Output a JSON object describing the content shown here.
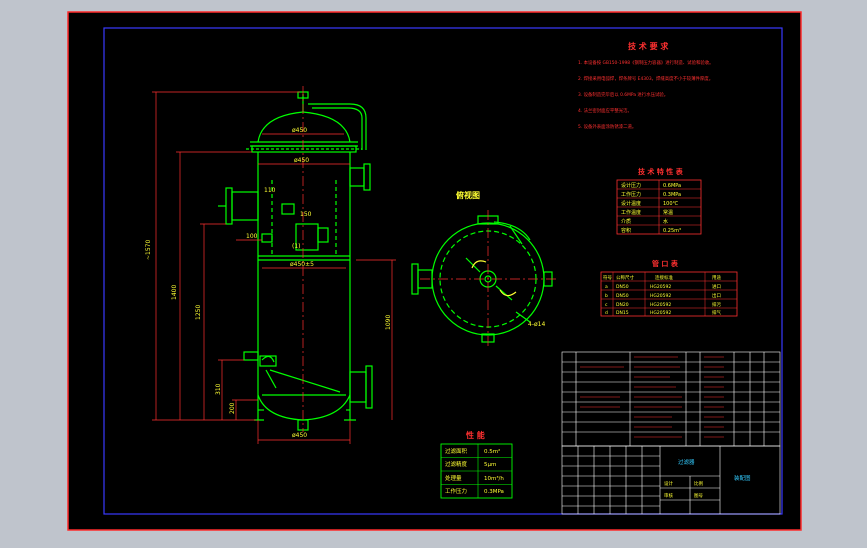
{
  "colors": {
    "viewport_bg": "#bfc4cc",
    "sheet_bg": "#000000",
    "outer_border": "#ff2a2a",
    "inner_border": "#3a3aff",
    "geometry": "#00ff00",
    "dimension": "#ff3030",
    "text_yellow": "#ffff33",
    "table_line": "#ffffff",
    "accent_cyan": "#33ccff",
    "accent_magenta": "#ff33ff"
  },
  "elevation": {
    "dia_top": "ø450",
    "dia_body": "ø450",
    "dia_inner": "ø450±5",
    "dia_bottom": "ø450",
    "overall_height": "~1570",
    "height_2": "1400",
    "height_3": "1250",
    "height_4": "1090",
    "height_5": "310",
    "height_6": "200",
    "nozzle_label_a": "110",
    "nozzle_label_b": "100",
    "nozzle_label_c": "150",
    "marker": "(1)"
  },
  "plan": {
    "title": "俯视图",
    "bolt_note": "4-ø14"
  },
  "tech_req": {
    "title": "技 术 要 求",
    "lines": [
      "1. 本设备按 GB150-1998《钢制压力容器》进行制造、试验和验收。",
      "2. 焊接采用电弧焊，焊条牌号 E4303，焊缝高度不小于较薄件厚度。",
      "3. 设备制造完毕后以 0.6MPa 进行水压试验。",
      "4. 法兰密封面应平整光洁。",
      "5. 设备外表面涂防锈漆二道。"
    ]
  },
  "spec_table": {
    "title": "技 术 特 性 表",
    "rows": [
      [
        "设计压力",
        "0.6MPa"
      ],
      [
        "工作压力",
        "0.3MPa"
      ],
      [
        "设计温度",
        "100℃"
      ],
      [
        "工作温度",
        "常温"
      ],
      [
        "介质",
        "水"
      ],
      [
        "容积",
        "0.25m³"
      ]
    ]
  },
  "nozzle_table": {
    "title": "管 口 表",
    "headers": [
      "符号",
      "公称尺寸",
      "连接标准",
      "用途"
    ],
    "rows": [
      [
        "a",
        "DN50",
        "HG20592",
        "进口"
      ],
      [
        "b",
        "DN50",
        "HG20592",
        "出口"
      ],
      [
        "c",
        "DN20",
        "HG20592",
        "排污"
      ],
      [
        "d",
        "DN15",
        "HG20592",
        "排气"
      ]
    ]
  },
  "performance": {
    "title": "性 能",
    "rows": [
      [
        "过滤面积",
        "0.5m²"
      ],
      [
        "过滤精度",
        "5μm"
      ],
      [
        "处理量",
        "10m³/h"
      ],
      [
        "工作压力",
        "0.3MPa"
      ]
    ]
  },
  "title_block": {
    "center_label": "过滤器",
    "right_label": "装配图",
    "labels": [
      "设计",
      "审核",
      "比例",
      "图号"
    ]
  }
}
